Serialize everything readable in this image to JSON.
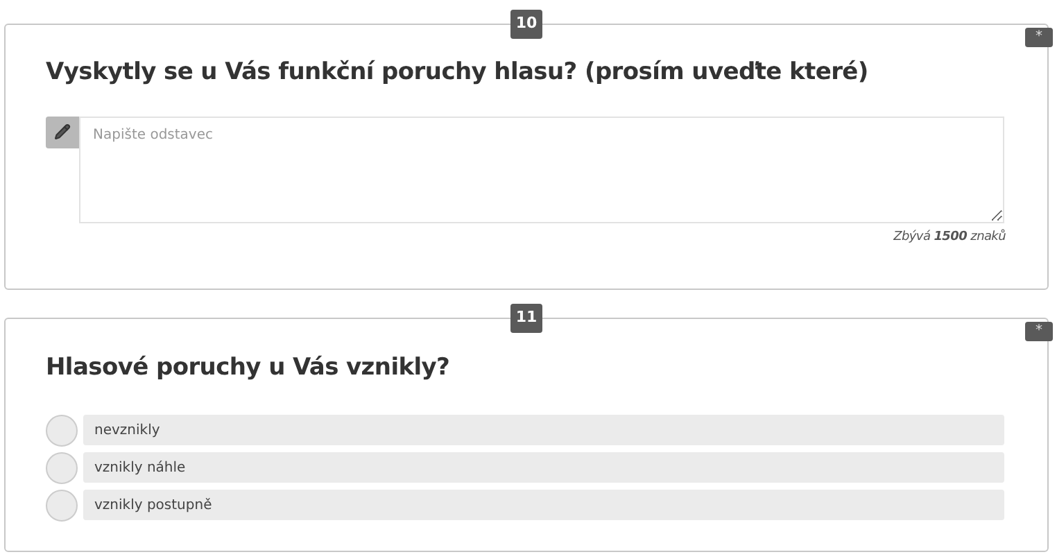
{
  "questions": [
    {
      "kind": "text",
      "number": "10",
      "required_mark": "*",
      "title": "Vyskytly se u Vás funkční poruchy hlasu? (prosím uveďte které)",
      "placeholder": "Napište odstavec",
      "counter": "Zbývá **1500** znaků"
    },
    {
      "kind": "radio",
      "number": "11",
      "required_mark": "*",
      "title": "Hlasové poruchy u Vás vznikly?",
      "options": [
        {
          "label": "nevznikly",
          "selected": false
        },
        {
          "label": "vznikly náhle",
          "selected": false
        },
        {
          "label": "vznikly postupně",
          "selected": false
        }
      ]
    }
  ]
}
